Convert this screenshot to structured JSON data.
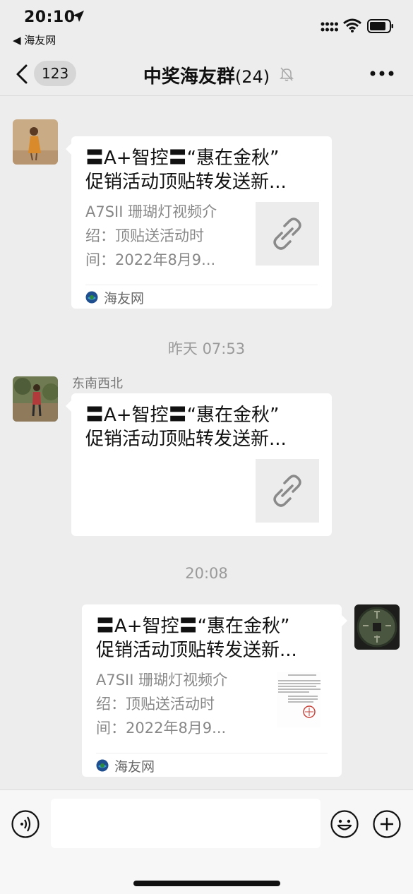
{
  "status_bar": {
    "time": "20:10",
    "back_app": "◀ 海友网"
  },
  "nav": {
    "unread_count": "123",
    "title": "中奖海友群",
    "member_count": "(24)"
  },
  "messages": [
    {
      "title": "〓A+智控〓“惠在金秋”\n促销活动顶贴转发送新...",
      "desc": "A7SII 珊瑚灯视频介\n绍：顶贴送活动时\n间：2022年8月9...",
      "source": "海友网"
    },
    {
      "sender": "东南西北",
      "title": "〓A+智控〓“惠在金秋”\n促销活动顶贴转发送新..."
    },
    {
      "title": "〓A+智控〓“惠在金秋”\n促销活动顶贴转发送新...",
      "desc": "A7SII 珊瑚灯视频介\n绍：顶贴送活动时\n间：2022年8月9...",
      "source": "海友网"
    }
  ],
  "timestamps": [
    "昨天 07:53",
    "20:08"
  ],
  "input": {
    "placeholder": ""
  },
  "icons": [
    "location-arrow-icon",
    "signal-icon",
    "wifi-icon",
    "battery-icon",
    "back-chevron-icon",
    "mute-bell-icon",
    "more-icon",
    "link-icon",
    "source-logo-icon",
    "voice-icon",
    "emoji-icon",
    "plus-icon"
  ],
  "colors": {
    "background": "#ededed",
    "card": "#ffffff",
    "meta_text": "#9a9a9a",
    "nav_badge": "#d6d6d6"
  }
}
